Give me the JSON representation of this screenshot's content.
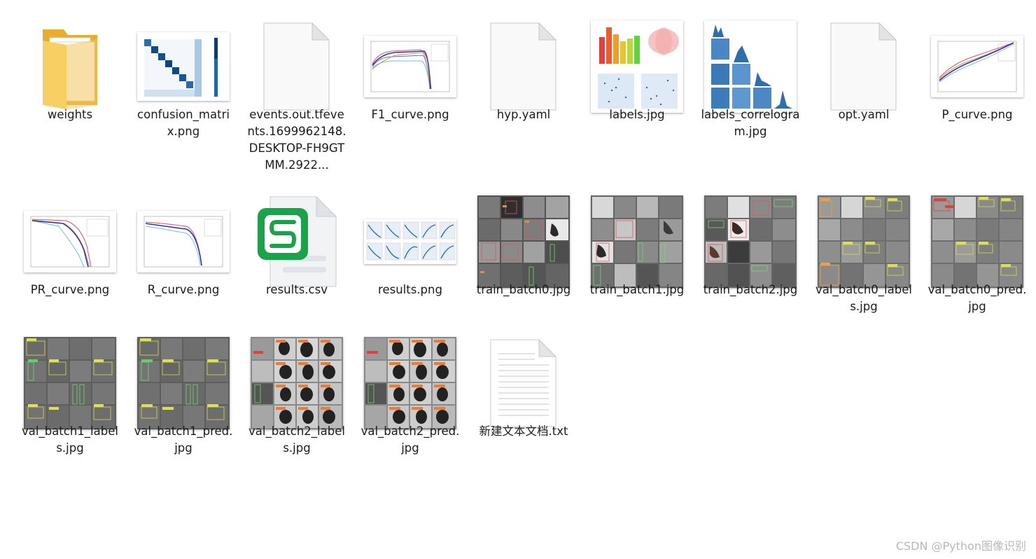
{
  "files": [
    {
      "name": "weights",
      "icon": "folder-icon"
    },
    {
      "name": "confusion_matrix.png",
      "icon": "image-thumbnail-icon"
    },
    {
      "name": "events.out.tfevents.1699962148.DESKTOP-FH9GTMM.2922...",
      "icon": "blank-file-icon"
    },
    {
      "name": "F1_curve.png",
      "icon": "image-thumbnail-icon"
    },
    {
      "name": "hyp.yaml",
      "icon": "blank-file-icon"
    },
    {
      "name": "labels.jpg",
      "icon": "image-thumbnail-icon"
    },
    {
      "name": "labels_correlogram.jpg",
      "icon": "image-thumbnail-icon"
    },
    {
      "name": "opt.yaml",
      "icon": "blank-file-icon"
    },
    {
      "name": "P_curve.png",
      "icon": "image-thumbnail-icon"
    },
    {
      "name": "PR_curve.png",
      "icon": "image-thumbnail-icon"
    },
    {
      "name": "R_curve.png",
      "icon": "image-thumbnail-icon"
    },
    {
      "name": "results.csv",
      "icon": "spreadsheet-icon"
    },
    {
      "name": "results.png",
      "icon": "image-thumbnail-icon"
    },
    {
      "name": "train_batch0.jpg",
      "icon": "image-thumbnail-icon"
    },
    {
      "name": "train_batch1.jpg",
      "icon": "image-thumbnail-icon"
    },
    {
      "name": "train_batch2.jpg",
      "icon": "image-thumbnail-icon"
    },
    {
      "name": "val_batch0_labels.jpg",
      "icon": "image-thumbnail-icon"
    },
    {
      "name": "val_batch0_pred.jpg",
      "icon": "image-thumbnail-icon"
    },
    {
      "name": "val_batch1_labels.jpg",
      "icon": "image-thumbnail-icon"
    },
    {
      "name": "val_batch1_pred.jpg",
      "icon": "image-thumbnail-icon"
    },
    {
      "name": "val_batch2_labels.jpg",
      "icon": "image-thumbnail-icon"
    },
    {
      "name": "val_batch2_pred.jpg",
      "icon": "image-thumbnail-icon"
    },
    {
      "name": "新建文本文档.txt",
      "icon": "text-file-icon"
    }
  ],
  "watermark": "CSDN @Python图像识别",
  "colors": {
    "folder": "#f5c451",
    "spreadsheet_brand": "#1aa34a",
    "label_text": "#1b1b1b",
    "watermark": "#b8b8b8"
  }
}
